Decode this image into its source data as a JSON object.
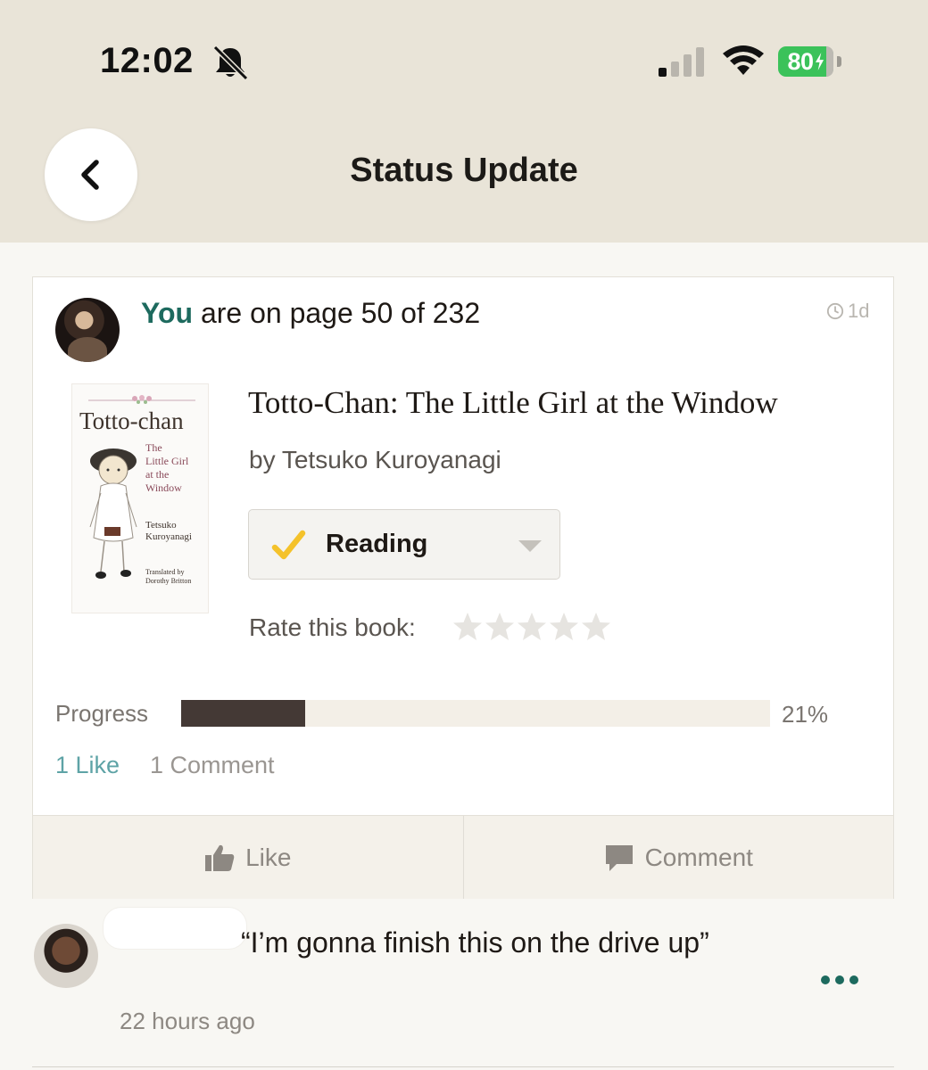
{
  "status_bar": {
    "time": "12:02",
    "battery": "80"
  },
  "header": {
    "title": "Status Update"
  },
  "update": {
    "actor": "You",
    "text": " are on page 50 of 232",
    "age": "1d"
  },
  "book": {
    "title": "Totto-Chan: The Little Girl at the Window",
    "author": "by Tetsuko Kuroyanagi",
    "cover": {
      "title": "Totto-chan",
      "subtitle": "The\nLittle Girl\nat the\nWindow",
      "author": "Tetsuko\nKuroyanagi",
      "translator": "Translated by\nDorothy Britton"
    },
    "shelf_status": "Reading",
    "rate_label": "Rate this book:",
    "rating": 0,
    "max_rating": 5
  },
  "progress": {
    "label": "Progress",
    "percent_text": "21%",
    "fraction": 0.21
  },
  "social": {
    "likes": "1 Like",
    "comments": "1 Comment"
  },
  "actions": {
    "like_label": "Like",
    "comment_label": "Comment"
  },
  "comment": {
    "text": "“I’m gonna finish this on the drive up”",
    "time": "22 hours ago"
  },
  "colors": {
    "header_bg": "#e9e4d8",
    "accent_green": "#1d6a5e",
    "progress_fill": "#443935",
    "like_teal": "#5ea3a6",
    "check_yellow": "#f4c22b",
    "battery_green": "#3bc25a"
  }
}
